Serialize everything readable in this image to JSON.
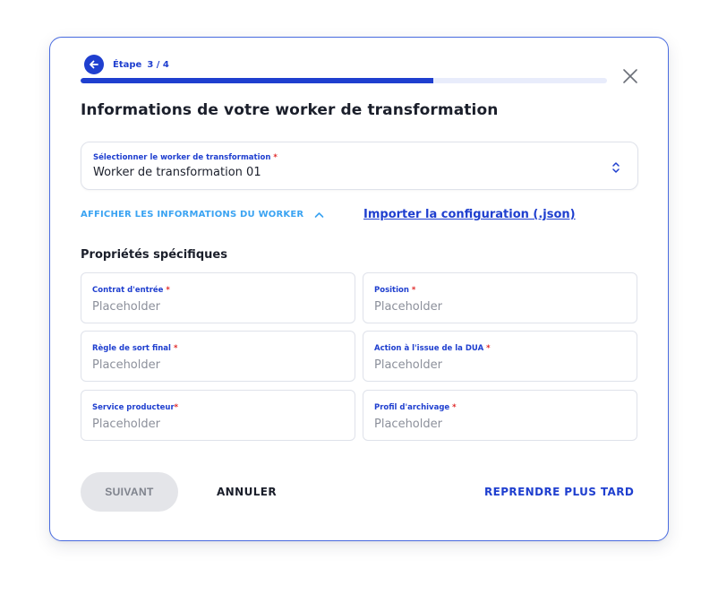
{
  "step": {
    "label": "Étape",
    "counter": "3 / 4",
    "progress": 0.67
  },
  "title": "Informations de votre worker de transformation",
  "worker_select": {
    "label": "Sélectionner le worker de transformation",
    "required_mark": "*",
    "value": "Worker de transformation 01"
  },
  "toggle_info_label": "AFFICHER LES INFORMATIONS DU WORKER",
  "import_link": "Importer la configuration (.json)",
  "section_title": "Propriétés spécifiques",
  "fields": [
    {
      "label": "Contrat d'entrée",
      "required_mark": "*",
      "placeholder": "Placeholder"
    },
    {
      "label": "Position",
      "required_mark": "*",
      "placeholder": "Placeholder"
    },
    {
      "label": "Règle de sort final",
      "required_mark": "*",
      "placeholder": "Placeholder"
    },
    {
      "label": "Action à l'issue de la DUA",
      "required_mark": "*",
      "placeholder": "Placeholder"
    },
    {
      "label": "Service producteur",
      "required_mark": "*",
      "placeholder": "Placeholder"
    },
    {
      "label": "Profil d'archivage",
      "required_mark": "*",
      "placeholder": "Placeholder"
    }
  ],
  "actions": {
    "next": "SUIVANT",
    "cancel": "ANNULER",
    "later": "REPRENDRE PLUS TARD"
  },
  "colors": {
    "primary": "#1f3fcf",
    "accent_light": "#3aa3f2",
    "required": "#e02828",
    "disabled_bg": "#e4e5e9"
  },
  "icons": {
    "back": "arrow-left-circle-icon",
    "close": "close-icon",
    "select": "chevron-updown-icon",
    "toggle": "chevron-up-icon"
  }
}
